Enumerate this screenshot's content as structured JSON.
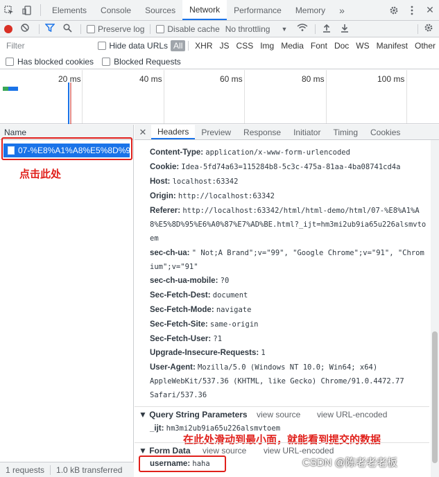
{
  "topbar": {
    "tabs": [
      "Elements",
      "Console",
      "Sources",
      "Network",
      "Performance",
      "Memory"
    ],
    "active_tab": "Network",
    "more": "»"
  },
  "toolbar": {
    "preserve_log": "Preserve log",
    "disable_cache": "Disable cache",
    "throttling": "No throttling"
  },
  "filter": {
    "placeholder": "Filter",
    "hide_data_urls": "Hide data URLs",
    "types": [
      "All",
      "XHR",
      "JS",
      "CSS",
      "Img",
      "Media",
      "Font",
      "Doc",
      "WS",
      "Manifest",
      "Other"
    ],
    "has_blocked_cookies": "Has blocked cookies",
    "blocked_requests": "Blocked Requests"
  },
  "overview": {
    "ticks": [
      "20 ms",
      "40 ms",
      "60 ms",
      "80 ms",
      "100 ms"
    ]
  },
  "request_list": {
    "column": "Name",
    "selected_request": "07-%E8%A1%A8%E5%8D%95...",
    "annotation": "点击此处",
    "status_requests": "1 requests",
    "status_transferred": "1.0 kB transferred"
  },
  "details": {
    "tabs": [
      "Headers",
      "Preview",
      "Response",
      "Initiator",
      "Timing",
      "Cookies"
    ],
    "active_tab": "Headers",
    "headers": [
      {
        "name": "Content-Type:",
        "value": "application/x-www-form-urlencoded"
      },
      {
        "name": "Cookie:",
        "value": "Idea-5fd74a63=115284b8-5c3c-475a-81aa-4ba08741cd4a"
      },
      {
        "name": "Host:",
        "value": "localhost:63342"
      },
      {
        "name": "Origin:",
        "value": "http://localhost:63342"
      },
      {
        "name": "Referer:",
        "value": "http://localhost:63342/html/html-demo/html/07-%E8%A1%A8%E5%8D%95%E6%A0%87%E7%AD%BE.html?_ijt=hm3mi2ub9ia65u226alsmvtoem"
      },
      {
        "name": "sec-ch-ua:",
        "value": "\" Not;A Brand\";v=\"99\", \"Google Chrome\";v=\"91\", \"Chromium\";v=\"91\""
      },
      {
        "name": "sec-ch-ua-mobile:",
        "value": "?0"
      },
      {
        "name": "Sec-Fetch-Dest:",
        "value": "document"
      },
      {
        "name": "Sec-Fetch-Mode:",
        "value": "navigate"
      },
      {
        "name": "Sec-Fetch-Site:",
        "value": "same-origin"
      },
      {
        "name": "Sec-Fetch-User:",
        "value": "?1"
      },
      {
        "name": "Upgrade-Insecure-Requests:",
        "value": "1"
      },
      {
        "name": "User-Agent:",
        "value": "Mozilla/5.0 (Windows NT 10.0; Win64; x64) AppleWebKit/537.36 (KHTML, like Gecko) Chrome/91.0.4472.77 Safari/537.36"
      }
    ],
    "query_section": {
      "title": "▼ Query String Parameters",
      "view_source": "view source",
      "view_url_encoded": "view URL-encoded",
      "param_name": "_ijt:",
      "param_value": "hm3mi2ub9ia65u226alsmvtoem"
    },
    "form_section": {
      "title": "▼ Form Data",
      "view_source": "view source",
      "view_url_encoded": "view URL-encoded",
      "field_name": "username:",
      "field_value": "haha"
    },
    "annotation": "在此处滑动到最小面，就能看到提交的数据"
  },
  "watermark": "CSDN @陈老老老板",
  "colors": {
    "accent": "#1a73e8",
    "annotation": "#e0201b",
    "record": "#d93025"
  }
}
